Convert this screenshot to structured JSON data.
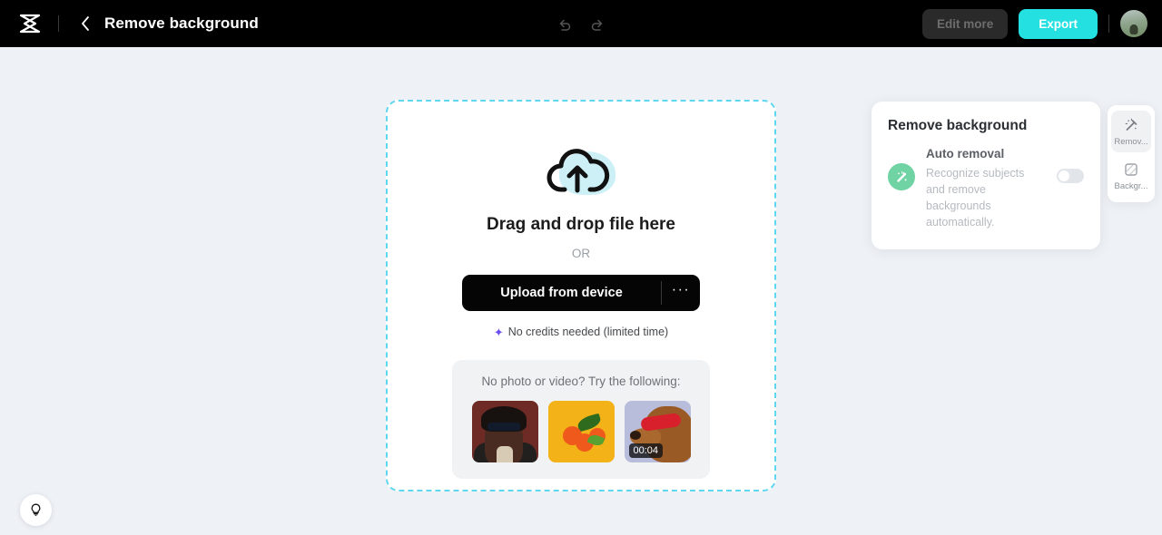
{
  "topbar": {
    "logo_icon": "capcut-logo-icon",
    "back_icon": "chevron-left-icon",
    "title": "Remove background",
    "undo_icon": "undo-icon",
    "redo_icon": "redo-icon",
    "edit_more_label": "Edit more",
    "export_label": "Export",
    "avatar_name": "user-avatar",
    "bg_color": "#000000",
    "export_color": "#25e0e0"
  },
  "dropzone": {
    "upload_icon": "cloud-upload-icon",
    "title": "Drag and drop file here",
    "or_label": "OR",
    "upload_button_label": "Upload from device",
    "more_label": "···",
    "credits_icon": "sparkle-icon",
    "credits_label": "No credits needed (limited time)",
    "border_color": "#5fd7ef",
    "samples": {
      "label": "No photo or video? Try the following:",
      "items": [
        {
          "name": "sample-portrait",
          "badge": ""
        },
        {
          "name": "sample-oranges",
          "badge": ""
        },
        {
          "name": "sample-dog-video",
          "badge": "00:04"
        }
      ]
    }
  },
  "right_panel": {
    "title": "Remove background",
    "wand_icon": "magic-wand-icon",
    "auto_title": "Auto removal",
    "auto_desc": "Recognize subjects and remove backgrounds automatically.",
    "toggle_state": "off",
    "accent_color": "#6fd3a3"
  },
  "right_rail": {
    "items": [
      {
        "label": "Remov...",
        "icon": "magic-wand-icon",
        "active": true
      },
      {
        "label": "Backgr...",
        "icon": "hatched-square-icon",
        "active": false
      }
    ]
  },
  "help": {
    "icon": "lightbulb-icon"
  },
  "page": {
    "background_color": "#eef1f5"
  }
}
